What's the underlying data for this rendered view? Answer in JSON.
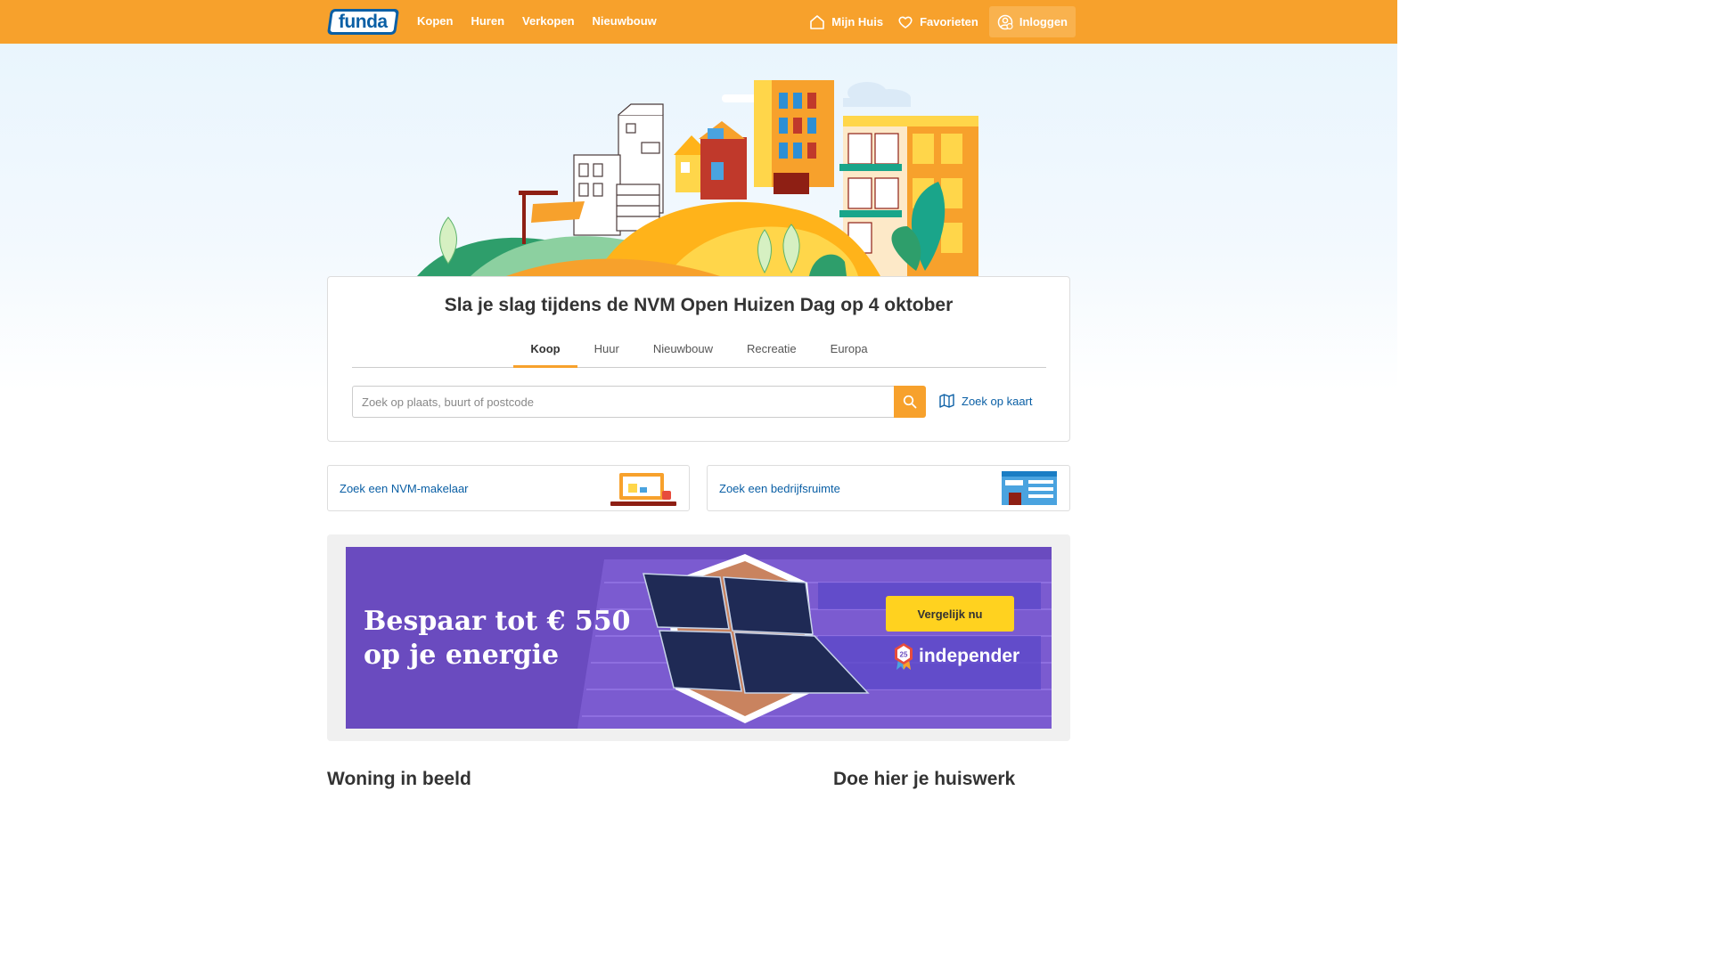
{
  "header": {
    "logo_text": "funda",
    "nav_left": [
      "Kopen",
      "Huren",
      "Verkopen",
      "Nieuwbouw"
    ],
    "nav_right": [
      {
        "label": "Mijn Huis",
        "icon": "house-icon"
      },
      {
        "label": "Favorieten",
        "icon": "heart-icon"
      },
      {
        "label": "Inloggen",
        "icon": "user-icon"
      }
    ]
  },
  "search": {
    "title": "Sla je slag tijdens de NVM Open Huizen Dag op 4 oktober",
    "tabs": [
      "Koop",
      "Huur",
      "Nieuwbouw",
      "Recreatie",
      "Europa"
    ],
    "active_tab": "Koop",
    "placeholder": "Zoek op plaats, buurt of postcode",
    "value": "",
    "map_link": "Zoek op kaart"
  },
  "link_cards": [
    {
      "label": "Zoek een NVM-makelaar"
    },
    {
      "label": "Zoek een bedrijfsruimte"
    }
  ],
  "ad": {
    "headline_line1": "Bespaar tot € 550",
    "headline_line2": "op je energie",
    "cta": "Vergelijk nu",
    "brand": "independer",
    "badge_number": "25"
  },
  "sections": {
    "left_heading": "Woning in beeld",
    "right_heading": "Doe hier je huiswerk"
  },
  "colors": {
    "brand_orange": "#f7a12c",
    "link_blue": "#0a5fa5",
    "ad_purple": "#6a4bbf",
    "cta_yellow": "#ffd21f"
  }
}
